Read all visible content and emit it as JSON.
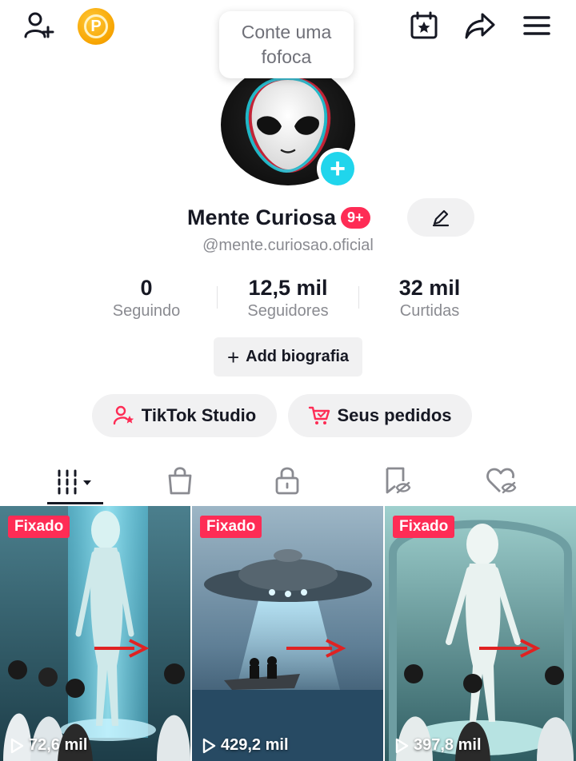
{
  "tooltip": {
    "text": "Conte uma fofoca"
  },
  "header": {
    "coin_letter": "P"
  },
  "profile": {
    "name": "Mente Curiosa",
    "badge": "9+",
    "handle": "@mente.curiosao.oficial"
  },
  "stats": [
    {
      "value": "0",
      "label": "Seguindo"
    },
    {
      "value": "12,5 mil",
      "label": "Seguidores"
    },
    {
      "value": "32 mil",
      "label": "Curtidas"
    }
  ],
  "bio_button": {
    "plus": "+",
    "label": "Add biografia"
  },
  "actions": {
    "studio_label": "TikTok Studio",
    "orders_label": "Seus pedidos"
  },
  "tabs": [
    "videos-grid",
    "shop-bag",
    "private-lock",
    "favorites-hidden",
    "liked-hidden"
  ],
  "videos": [
    {
      "pinned": "Fixado",
      "views": "72,6 mil"
    },
    {
      "pinned": "Fixado",
      "views": "429,2 mil"
    },
    {
      "pinned": "Fixado",
      "views": "397,8 mil"
    }
  ],
  "colors": {
    "accent": "#fe2c55",
    "teal": "#20d5ec",
    "text": "#161823",
    "muted": "#8a8b91"
  }
}
